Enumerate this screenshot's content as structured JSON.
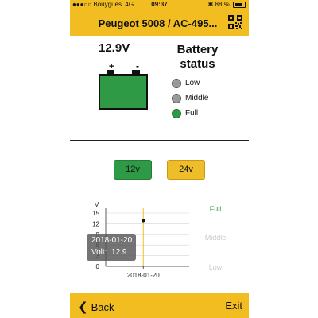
{
  "status_bar": {
    "carrier": "●●●○○ Bouygues",
    "network": "4G",
    "time": "09:37",
    "bluetooth": "✱",
    "battery_percent": "88 %"
  },
  "header": {
    "title": "Peugeot 5008 / AC-495...",
    "qr_icon": "qr-code-icon"
  },
  "battery": {
    "voltage": "12.9V",
    "plus": "+",
    "minus": "-",
    "status_title_line1": "Battery",
    "status_title_line2": "status",
    "legend": [
      {
        "label": "Low",
        "color": "#9a9a9a"
      },
      {
        "label": "Middle",
        "color": "#9a9a9a"
      },
      {
        "label": "Full",
        "color": "#2e9a46"
      }
    ],
    "fill_color": "#2e9a46"
  },
  "voltage_buttons": {
    "b12": "12v",
    "b24": "24v"
  },
  "chart_data": {
    "type": "scatter",
    "ylabel": "V",
    "yticks": [
      "15",
      "12",
      "9",
      "6",
      "3",
      "0"
    ],
    "ylim": [
      0,
      15
    ],
    "x": [
      "2018-01-20"
    ],
    "values": [
      12.9
    ],
    "zones": [
      "Full",
      "Middle",
      "Low"
    ],
    "marker_line_color": "#f2bd21"
  },
  "tooltip": {
    "date": "2018-01-20",
    "volt_label": "Volt:",
    "volt_value": "12.9"
  },
  "footer": {
    "back": "Back",
    "exit": "Exit"
  },
  "colors": {
    "accent": "#f2bd21",
    "green": "#2e9a46"
  }
}
